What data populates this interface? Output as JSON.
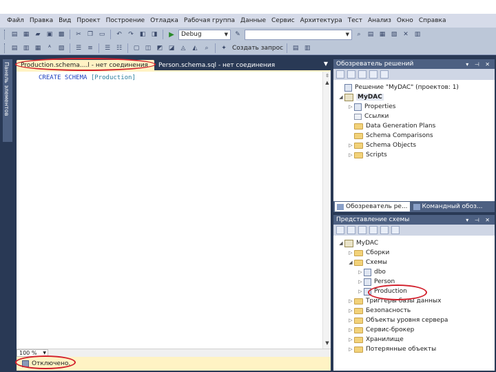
{
  "menu": [
    "Файл",
    "Правка",
    "Вид",
    "Проект",
    "Построение",
    "Отладка",
    "Рабочая группа",
    "Данные",
    "Сервис",
    "Архитектура",
    "Тест",
    "Анализ",
    "Окно",
    "Справка"
  ],
  "toolbar": {
    "config_value": "Debug",
    "platform_value": "",
    "create_query_label": "Создать запрос"
  },
  "left_strip": {
    "label": "Панель элементов"
  },
  "document_tabs": [
    {
      "label": "Production.schema....l - нет соединения",
      "active": true
    },
    {
      "label": "Person.schema.sql - нет соединения",
      "active": false
    }
  ],
  "editor": {
    "code_keywords": "CREATE SCHEMA",
    "code_identifier": "[Production]",
    "zoom": "100 %"
  },
  "status": {
    "text": "Отключено."
  },
  "solution_explorer": {
    "title": "Обозреватель решений",
    "items": [
      {
        "label": "Решение \"MyDAC\" (проектов: 1)",
        "level": 0,
        "icon": "solution-icon",
        "expander": ""
      },
      {
        "label": "MyDAC",
        "level": 0,
        "icon": "project-icon",
        "expander": "◢",
        "bold": true
      },
      {
        "label": "Properties",
        "level": 1,
        "icon": "properties-icon",
        "expander": "▷"
      },
      {
        "label": "Ссылки",
        "level": 1,
        "icon": "references-icon",
        "expander": ""
      },
      {
        "label": "Data Generation Plans",
        "level": 1,
        "icon": "folder-icon",
        "expander": ""
      },
      {
        "label": "Schema Comparisons",
        "level": 1,
        "icon": "folder-icon",
        "expander": ""
      },
      {
        "label": "Schema Objects",
        "level": 1,
        "icon": "folder-icon",
        "expander": "▷"
      },
      {
        "label": "Scripts",
        "level": 1,
        "icon": "folder-icon",
        "expander": "▷"
      }
    ],
    "tabs": [
      "Обозреватель ре...",
      "Командный обоз..."
    ]
  },
  "schema_view": {
    "title": "Представление схемы",
    "items": [
      {
        "label": "MyDAC",
        "level": 0,
        "icon": "project-icon",
        "expander": "◢"
      },
      {
        "label": "Сборки",
        "level": 1,
        "icon": "folder-icon",
        "expander": "▷"
      },
      {
        "label": "Схемы",
        "level": 1,
        "icon": "folder-icon",
        "expander": "◢"
      },
      {
        "label": "dbo",
        "level": 2,
        "icon": "schema-icon",
        "expander": "▷"
      },
      {
        "label": "Person",
        "level": 2,
        "icon": "schema-icon",
        "expander": "▷"
      },
      {
        "label": "Production",
        "level": 2,
        "icon": "schema-icon",
        "expander": "▷"
      },
      {
        "label": "Триггеры базы данных",
        "level": 1,
        "icon": "folder-icon",
        "expander": "▷"
      },
      {
        "label": "Безопасность",
        "level": 1,
        "icon": "folder-icon",
        "expander": "▷"
      },
      {
        "label": "Объекты уровня сервера",
        "level": 1,
        "icon": "folder-icon",
        "expander": "▷"
      },
      {
        "label": "Сервис-брокер",
        "level": 1,
        "icon": "folder-icon",
        "expander": "▷"
      },
      {
        "label": "Хранилище",
        "level": 1,
        "icon": "folder-icon",
        "expander": "▷"
      },
      {
        "label": "Потерянные объекты",
        "level": 1,
        "icon": "folder-icon",
        "expander": "▷"
      }
    ]
  },
  "colors": {
    "chrome": "#293955",
    "panel_title": "#4d6082",
    "active_tab": "#fff3c4",
    "annotation": "#d21f2b"
  }
}
